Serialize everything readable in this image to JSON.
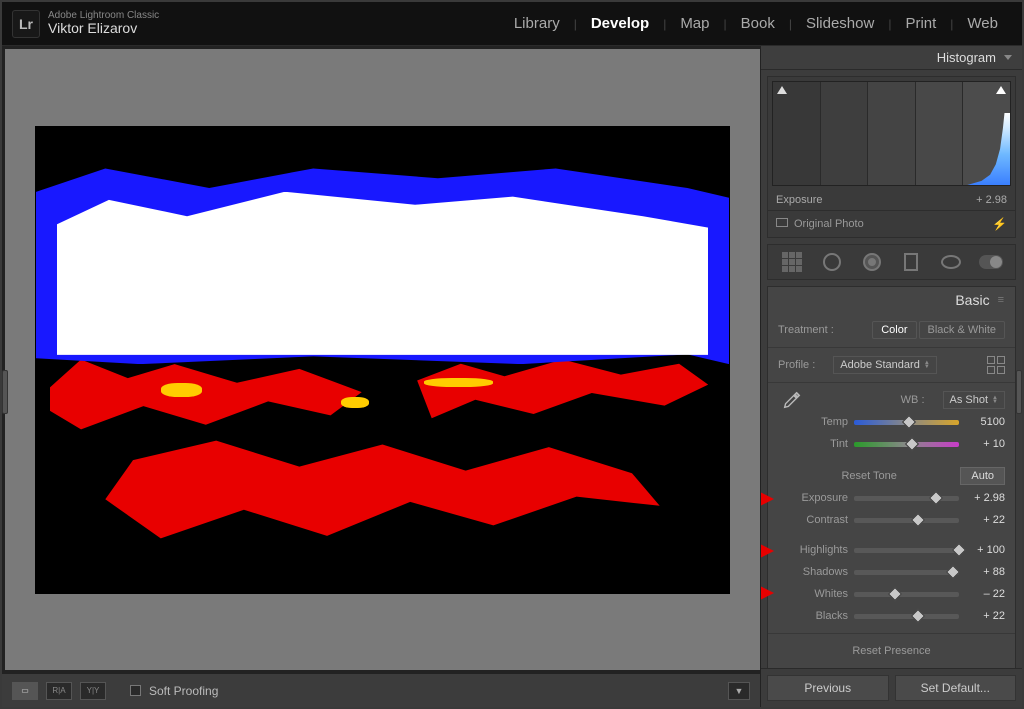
{
  "app": {
    "name": "Adobe Lightroom Classic",
    "user": "Viktor Elizarov",
    "logo": "Lr"
  },
  "modules": {
    "items": [
      "Library",
      "Develop",
      "Map",
      "Book",
      "Slideshow",
      "Print",
      "Web"
    ],
    "active": "Develop"
  },
  "canvas_footer": {
    "view_single": "◻",
    "view_compare": "R|A",
    "view_ba": "Y|Y",
    "soft_proofing": "Soft Proofing"
  },
  "histogram": {
    "title": "Histogram",
    "meta_label": "Exposure",
    "meta_value": "+ 2.98",
    "original_label": "Original Photo"
  },
  "basic": {
    "title": "Basic",
    "treatment_label": "Treatment :",
    "treatment_color": "Color",
    "treatment_bw": "Black & White",
    "profile_label": "Profile :",
    "profile_value": "Adobe Standard",
    "wb_label": "WB :",
    "wb_value": "As Shot",
    "temp": {
      "label": "Temp",
      "value": "5100",
      "pct": 52
    },
    "tint": {
      "label": "Tint",
      "value": "+ 10",
      "pct": 55
    },
    "reset_tone": "Reset Tone",
    "auto": "Auto",
    "sliders": {
      "exposure": {
        "label": "Exposure",
        "value": "+ 2.98",
        "pct": 78
      },
      "contrast": {
        "label": "Contrast",
        "value": "+ 22",
        "pct": 61
      },
      "highlights": {
        "label": "Highlights",
        "value": "+ 100",
        "pct": 100
      },
      "shadows": {
        "label": "Shadows",
        "value": "+ 88",
        "pct": 94
      },
      "whites": {
        "label": "Whites",
        "value": "– 22",
        "pct": 39
      },
      "blacks": {
        "label": "Blacks",
        "value": "+ 22",
        "pct": 61
      }
    },
    "reset_presence": "Reset Presence"
  },
  "footer": {
    "previous": "Previous",
    "set_default": "Set Default..."
  }
}
